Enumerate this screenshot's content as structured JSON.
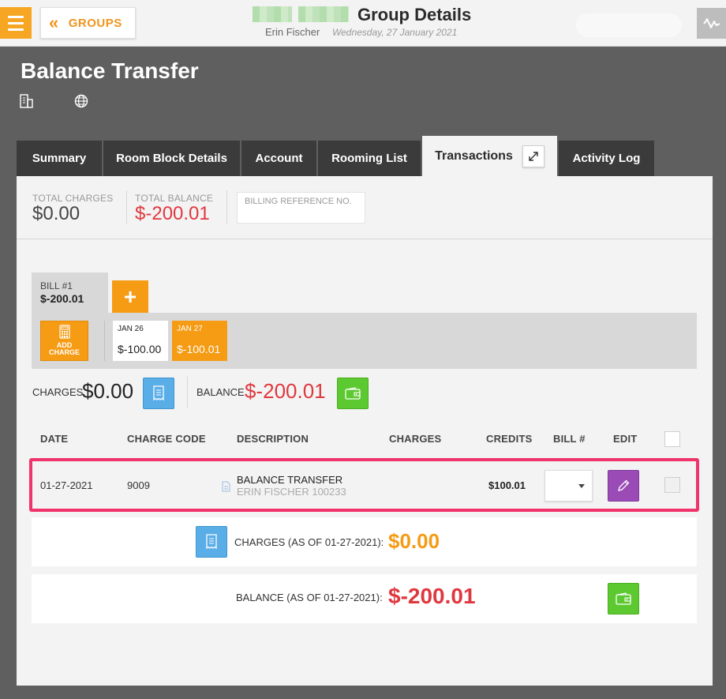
{
  "topbar": {
    "back_label": "GROUPS",
    "title": "Group Details",
    "user": "Erin Fischer",
    "date": "Wednesday, 27 January 2021"
  },
  "page": {
    "title": "Balance Transfer"
  },
  "tabs": [
    {
      "label": "Summary"
    },
    {
      "label": "Room Block Details"
    },
    {
      "label": "Account"
    },
    {
      "label": "Rooming List"
    },
    {
      "label": "Transactions"
    },
    {
      "label": "Activity Log"
    }
  ],
  "stats": {
    "total_charges_label": "TOTAL CHARGES",
    "total_charges_value": "$0.00",
    "total_balance_label": "TOTAL BALANCE",
    "total_balance_value": "$-200.01",
    "billing_ref_placeholder": "BILLING REFERENCE NO."
  },
  "bill": {
    "label": "BILL #1",
    "value": "$-200.01",
    "add_symbol": "+",
    "add_charge_label_1": "ADD",
    "add_charge_label_2": "CHARGE",
    "days": [
      {
        "label": "JAN 26",
        "value": "$-100.00"
      },
      {
        "label": "JAN 27",
        "value": "$-100.01"
      }
    ]
  },
  "summary": {
    "charges_label": "CHARGES",
    "charges_value": "$0.00",
    "balance_label": "BALANCE",
    "balance_value": "$-200.01"
  },
  "table": {
    "headers": [
      "DATE",
      "CHARGE CODE",
      "DESCRIPTION",
      "CHARGES",
      "CREDITS",
      "BILL #",
      "EDIT"
    ],
    "rows": [
      {
        "date": "01-27-2021",
        "charge_code": "9009",
        "description": "BALANCE TRANSFER",
        "sub_description": "ERIN FISCHER 100233",
        "charges": "",
        "credits": "$100.01"
      }
    ]
  },
  "totals": {
    "charges_label": "CHARGES (AS OF 01-27-2021):",
    "charges_value": "$0.00",
    "balance_label": "BALANCE (AS OF 01-27-2021):",
    "balance_value": "$-200.01"
  },
  "colors": {
    "accent_orange": "#f59b14",
    "negative_red": "#e0383f",
    "highlight_pink": "#f0336a",
    "receipt_blue": "#5aaee8",
    "wallet_green": "#5dc931",
    "edit_purple": "#9a4bb6"
  },
  "icons": {
    "menu": "hamburger-icon",
    "back": "double-chevron-left-icon",
    "activity": "activity-graph-icon",
    "property": "building-icon",
    "web": "globe-icon",
    "expand": "expand-icon",
    "receipt": "receipt-icon",
    "wallet": "wallet-icon",
    "edit": "pencil-icon",
    "calculator": "calculator-icon",
    "document": "document-icon"
  }
}
